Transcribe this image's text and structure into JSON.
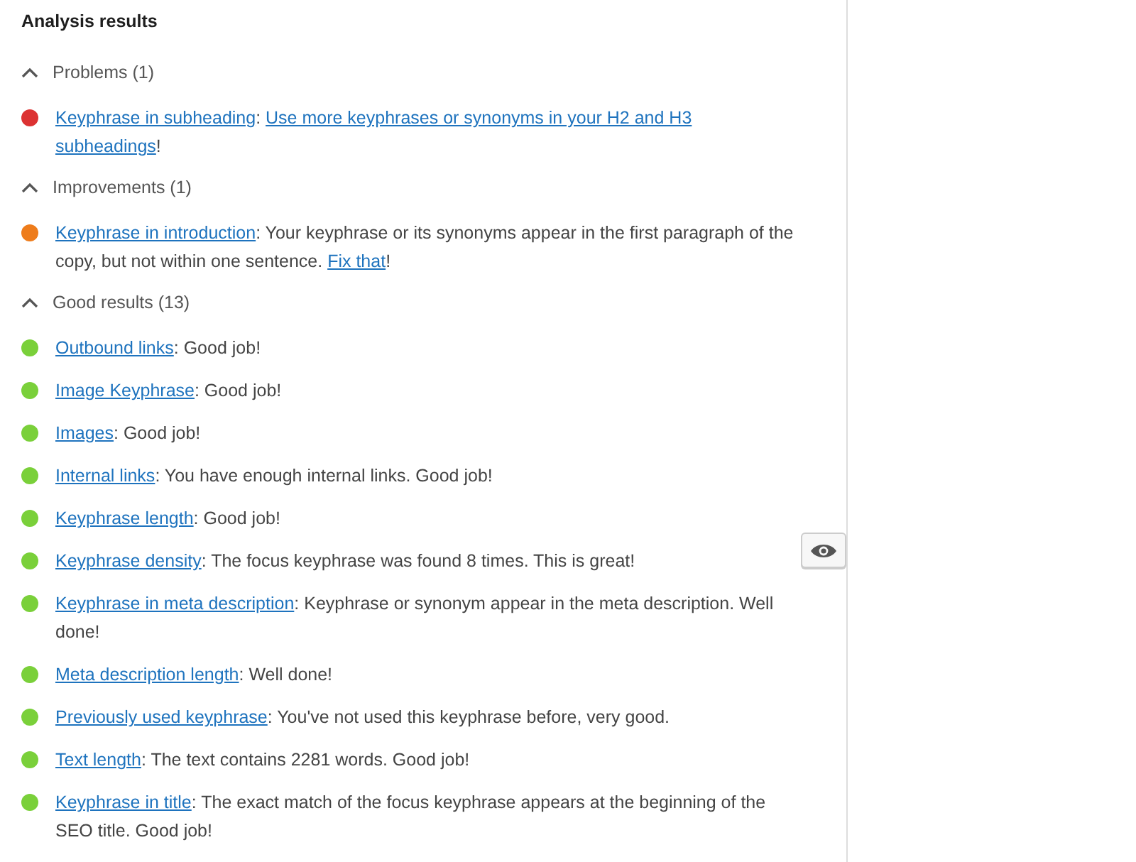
{
  "title": "Analysis results",
  "sections": [
    {
      "heading": "Problems (1)",
      "expanded": true,
      "results": [
        {
          "color": "#dc3232",
          "marker_button": false,
          "segments": [
            {
              "kind": "link",
              "text": "Keyphrase in subheading"
            },
            {
              "kind": "plain",
              "text": ": "
            },
            {
              "kind": "link",
              "text": "Use more keyphrases or synonyms in your H2 and H3"
            },
            {
              "kind": "link_continued",
              "text": "subheadings"
            },
            {
              "kind": "plain",
              "text": "!"
            }
          ]
        }
      ]
    },
    {
      "heading": "Improvements (1)",
      "expanded": true,
      "results": [
        {
          "color": "#ee7c1b",
          "marker_button": false,
          "segments": [
            {
              "kind": "link",
              "text": "Keyphrase in introduction"
            },
            {
              "kind": "plain",
              "text": ": Your keyphrase or its synonyms appear in the first paragraph of the copy, but not within one sentence. "
            },
            {
              "kind": "link",
              "text": "Fix that"
            },
            {
              "kind": "plain",
              "text": "!"
            }
          ]
        }
      ]
    },
    {
      "heading": "Good results (13)",
      "expanded": true,
      "results": [
        {
          "color": "#7ad03a",
          "marker_button": false,
          "segments": [
            {
              "kind": "link",
              "text": "Outbound links"
            },
            {
              "kind": "plain",
              "text": ": Good job!"
            }
          ]
        },
        {
          "color": "#7ad03a",
          "marker_button": false,
          "segments": [
            {
              "kind": "link",
              "text": "Image Keyphrase"
            },
            {
              "kind": "plain",
              "text": ": Good job!"
            }
          ]
        },
        {
          "color": "#7ad03a",
          "marker_button": false,
          "segments": [
            {
              "kind": "link",
              "text": "Images"
            },
            {
              "kind": "plain",
              "text": ": Good job!"
            }
          ]
        },
        {
          "color": "#7ad03a",
          "marker_button": false,
          "segments": [
            {
              "kind": "link",
              "text": "Internal links"
            },
            {
              "kind": "plain",
              "text": ": You have enough internal links. Good job!"
            }
          ]
        },
        {
          "color": "#7ad03a",
          "marker_button": false,
          "segments": [
            {
              "kind": "link",
              "text": "Keyphrase length"
            },
            {
              "kind": "plain",
              "text": ": Good job!"
            }
          ]
        },
        {
          "color": "#7ad03a",
          "marker_button": true,
          "segments": [
            {
              "kind": "link",
              "text": "Keyphrase density"
            },
            {
              "kind": "plain",
              "text": ": The focus keyphrase was found 8 times. This is great!"
            }
          ]
        },
        {
          "color": "#7ad03a",
          "marker_button": false,
          "segments": [
            {
              "kind": "link",
              "text": "Keyphrase in meta description"
            },
            {
              "kind": "plain",
              "text": ": Keyphrase or synonym appear in the meta description. Well done!"
            }
          ]
        },
        {
          "color": "#7ad03a",
          "marker_button": false,
          "segments": [
            {
              "kind": "link",
              "text": "Meta description length"
            },
            {
              "kind": "plain",
              "text": ": Well done!"
            }
          ]
        },
        {
          "color": "#7ad03a",
          "marker_button": false,
          "segments": [
            {
              "kind": "link",
              "text": "Previously used keyphrase"
            },
            {
              "kind": "plain",
              "text": ": You've not used this keyphrase before, very good."
            }
          ]
        },
        {
          "color": "#7ad03a",
          "marker_button": false,
          "segments": [
            {
              "kind": "link",
              "text": "Text length"
            },
            {
              "kind": "plain",
              "text": ": The text contains 2281 words. Good job!"
            }
          ]
        },
        {
          "color": "#7ad03a",
          "marker_button": false,
          "segments": [
            {
              "kind": "link",
              "text": "Keyphrase in title"
            },
            {
              "kind": "plain",
              "text": ": The exact match of the focus keyphrase appears at the beginning of the SEO title. Good job!"
            }
          ]
        }
      ]
    }
  ]
}
